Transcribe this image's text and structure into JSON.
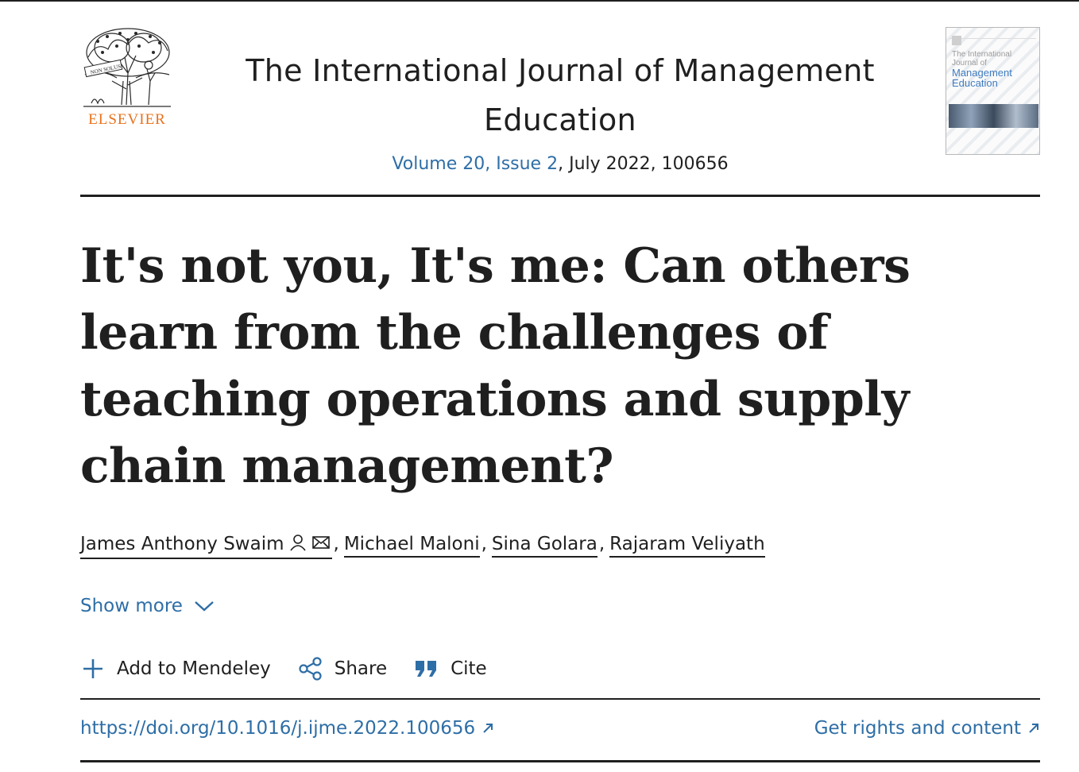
{
  "publisher": {
    "name": "ELSEVIER",
    "logo_icon": "elsevier-tree-logo",
    "motto": "NON SOLUS"
  },
  "journal": {
    "title": "The International Journal of Management Education",
    "volume_issue_link": "Volume 20, Issue 2",
    "issue_rest": ", July 2022, 100656",
    "cover": {
      "line1": "The International",
      "line2": "Journal of",
      "line3": "Management",
      "line4": "Education"
    }
  },
  "article": {
    "title": "It's not you, It's me: Can others learn from the challenges of teaching operations and supply chain management?"
  },
  "authors": [
    {
      "name": "James Anthony Swaim",
      "icons": [
        "person-icon",
        "envelope-icon"
      ]
    },
    {
      "name": "Michael Maloni"
    },
    {
      "name": "Sina Golara"
    },
    {
      "name": "Rajaram Veliyath"
    }
  ],
  "authors_separator": ",",
  "show_more": {
    "label": "Show more",
    "icon": "chevron-down-icon"
  },
  "actions": {
    "mendeley": {
      "label": "Add to Mendeley",
      "icon": "plus-icon"
    },
    "share": {
      "label": "Share",
      "icon": "share-icon"
    },
    "cite": {
      "label": "Cite",
      "icon": "quote-icon"
    }
  },
  "links": {
    "doi": "https://doi.org/10.1016/j.ijme.2022.100656",
    "rights": "Get rights and content"
  },
  "colors": {
    "link": "#2e6ea6",
    "publisher": "#e9711c",
    "text": "#1f1f1f"
  }
}
